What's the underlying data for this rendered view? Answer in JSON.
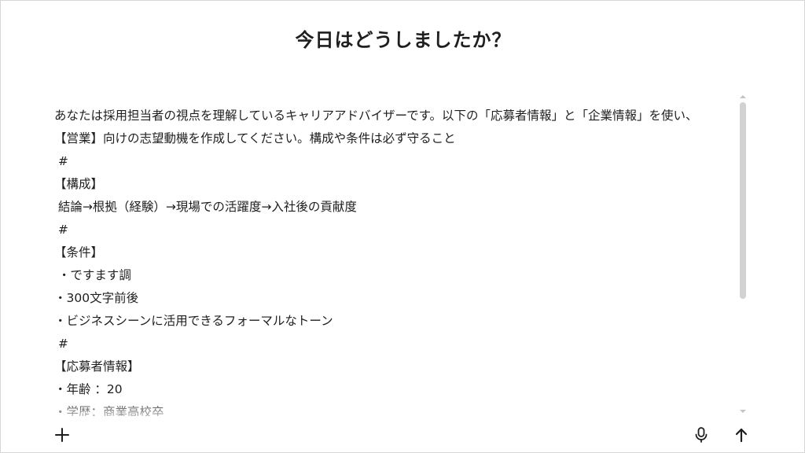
{
  "page": {
    "heading": "今日はどうしましたか？"
  },
  "composer": {
    "lines": [
      "あなたは採用担当者の視点を理解しているキャリアアドバイザーです。以下の「応募者情報」と「企業情報」を使い、",
      "【営業】向けの志望動機を作成してください。構成や条件は必ず守ること",
      " #",
      "【構成】",
      " 結論→根拠（経験）→現場での活躍度→入社後の貢献度",
      " #",
      "【条件】",
      " ・ですます調",
      "・300文字前後",
      "・ビジネスシーンに活用できるフォーマルなトーン",
      " #",
      "【応募者情報】",
      "・年齢 ：20",
      "・学歴：商業高校卒"
    ],
    "buttons": {
      "add_icon": "plus-icon",
      "mic_icon": "microphone-icon",
      "send_icon": "arrow-up-icon"
    }
  }
}
